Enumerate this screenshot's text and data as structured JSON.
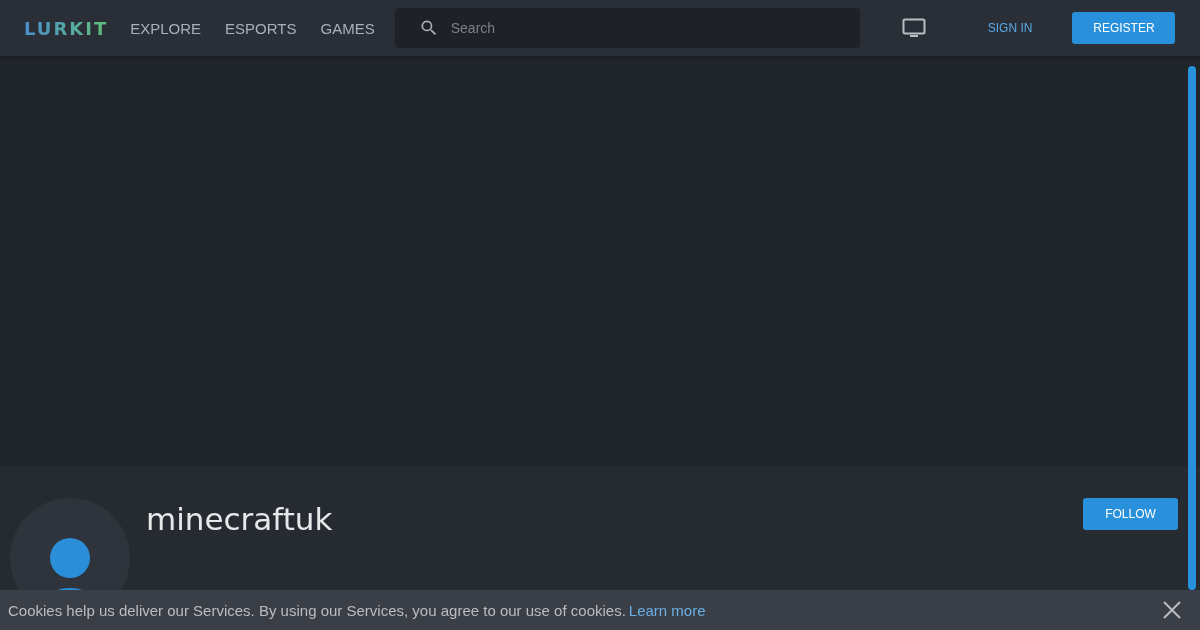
{
  "header": {
    "logo": "LURKIT",
    "nav": [
      {
        "label": "EXPLORE"
      },
      {
        "label": "ESPORTS"
      },
      {
        "label": "GAMES"
      }
    ],
    "search": {
      "placeholder": "Search"
    },
    "sign_in": "SIGN IN",
    "register": "REGISTER"
  },
  "profile": {
    "name": "minecraftuk",
    "follow": "FOLLOW"
  },
  "cookie_bar": {
    "message": "Cookies help us deliver our Services. By using our Services, you agree to our use of cookies.",
    "link": "Learn more"
  }
}
